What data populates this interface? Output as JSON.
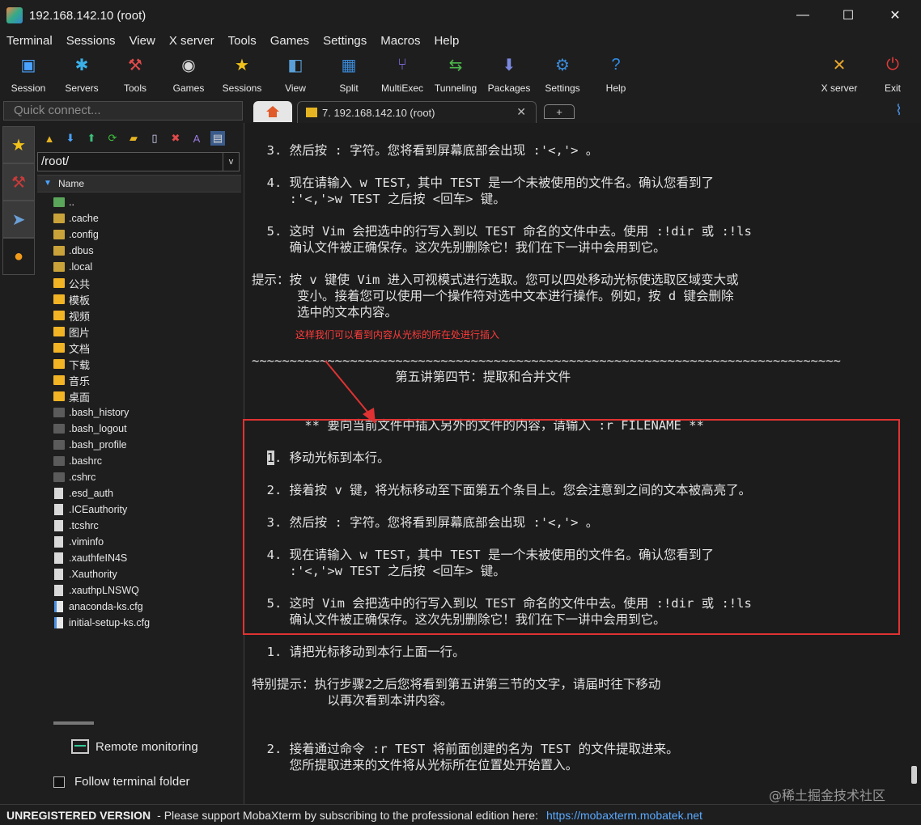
{
  "window": {
    "title": "192.168.142.10 (root)",
    "minimize": "—",
    "maximize": "☐",
    "close": "✕"
  },
  "menu": [
    "Terminal",
    "Sessions",
    "View",
    "X server",
    "Tools",
    "Games",
    "Settings",
    "Macros",
    "Help"
  ],
  "toolbar": {
    "items": [
      {
        "label": "Session",
        "icon": "session-icon",
        "glyph": "▣",
        "color": "#4aa3ff"
      },
      {
        "label": "Servers",
        "icon": "servers-icon",
        "glyph": "✱",
        "color": "#3ab0e8"
      },
      {
        "label": "Tools",
        "icon": "tools-icon",
        "glyph": "⚒",
        "color": "#e04a4a"
      },
      {
        "label": "Games",
        "icon": "games-icon",
        "glyph": "◉",
        "color": "#d8d8d8"
      },
      {
        "label": "Sessions",
        "icon": "sessions-star-icon",
        "glyph": "★",
        "color": "#f2c21b"
      },
      {
        "label": "View",
        "icon": "view-icon",
        "glyph": "◧",
        "color": "#5aa0d8"
      },
      {
        "label": "Split",
        "icon": "split-icon",
        "glyph": "▦",
        "color": "#3a8ad8"
      },
      {
        "label": "MultiExec",
        "icon": "multiexec-icon",
        "glyph": "⑂",
        "color": "#7a6ad8"
      },
      {
        "label": "Tunneling",
        "icon": "tunneling-icon",
        "glyph": "⇆",
        "color": "#4cb84c"
      },
      {
        "label": "Packages",
        "icon": "packages-icon",
        "glyph": "⬇",
        "color": "#7a8ae0"
      },
      {
        "label": "Settings",
        "icon": "settings-icon",
        "glyph": "⚙",
        "color": "#3a8ad8"
      },
      {
        "label": "Help",
        "icon": "help-icon",
        "glyph": "?",
        "color": "#2f8de4"
      },
      {
        "label": "X server",
        "icon": "xserver-icon",
        "glyph": "✕",
        "color": "#e6a52c"
      },
      {
        "label": "Exit",
        "icon": "exit-icon",
        "glyph": "⏻",
        "color": "#e63a3a"
      }
    ]
  },
  "quick_connect": {
    "placeholder": "Quick connect..."
  },
  "tabs": {
    "session_label": "7. 192.168.142.10 (root)",
    "close": "✕",
    "new_tab": "+"
  },
  "sidebar": {
    "path": "/root/",
    "column_header": "Name",
    "files": [
      {
        "name": "..",
        "type": "up"
      },
      {
        "name": ".cache",
        "type": "dot"
      },
      {
        "name": ".config",
        "type": "dot"
      },
      {
        "name": ".dbus",
        "type": "dot"
      },
      {
        "name": ".local",
        "type": "dot"
      },
      {
        "name": "公共",
        "type": "folder"
      },
      {
        "name": "模板",
        "type": "folder"
      },
      {
        "name": "视频",
        "type": "folder"
      },
      {
        "name": "图片",
        "type": "folder"
      },
      {
        "name": "文档",
        "type": "folder"
      },
      {
        "name": "下载",
        "type": "folder"
      },
      {
        "name": "音乐",
        "type": "folder"
      },
      {
        "name": "桌面",
        "type": "folder"
      },
      {
        "name": ".bash_history",
        "type": "hidden"
      },
      {
        "name": ".bash_logout",
        "type": "hidden"
      },
      {
        "name": ".bash_profile",
        "type": "hidden"
      },
      {
        "name": ".bashrc",
        "type": "hidden"
      },
      {
        "name": ".cshrc",
        "type": "hidden"
      },
      {
        "name": ".esd_auth",
        "type": "file"
      },
      {
        "name": ".ICEauthority",
        "type": "file"
      },
      {
        "name": ".tcshrc",
        "type": "file"
      },
      {
        "name": ".viminfo",
        "type": "file"
      },
      {
        "name": ".xauthfeIN4S",
        "type": "file"
      },
      {
        "name": ".Xauthority",
        "type": "file"
      },
      {
        "name": ".xauthpLNSWQ",
        "type": "file"
      },
      {
        "name": "anaconda-ks.cfg",
        "type": "cfg"
      },
      {
        "name": "initial-setup-ks.cfg",
        "type": "cfg"
      }
    ],
    "remote_monitoring": "Remote monitoring",
    "follow_terminal": "Follow terminal folder"
  },
  "terminal": {
    "lines": [
      "  3. 然后按 : 字符。您将看到屏幕底部会出现 :'<,'> 。",
      "",
      "  4. 现在请输入 w TEST，其中 TEST 是一个未被使用的文件名。确认您看到了",
      "     :'<,'>w TEST 之后按 <回车> 键。",
      "",
      "  5. 这时 Vim 会把选中的行写入到以 TEST 命名的文件中去。使用 :!dir 或 :!ls",
      "     确认文件被正确保存。这次先别删除它！我们在下一讲中会用到它。",
      "",
      "提示：按 v 键使 Vim 进入可视模式进行选取。您可以四处移动光标使选取区域变大或",
      "      变小。接着您可以使用一个操作符对选中文本进行操作。例如，按 d 键会删除",
      "      选中的文本内容。",
      "",
      "",
      "~~~~~~~~~~~~~~~~~~~~~~~~~~~~~~~~~~~~~~~~~~~~~~~~~~~~~~~~~~~~~~~~~~~~~~~~~~~~~~",
      "                   第五讲第四节：提取和合并文件",
      "",
      "",
      "       ** 要向当前文件中插入另外的文件的内容，请输入 :r FILENAME **",
      "",
      "  1. 移动光标到本行。",
      "",
      "  2. 接着按 v 键，将光标移动至下面第五个条目上。您会注意到之间的文本被高亮了。",
      "",
      "  3. 然后按 : 字符。您将看到屏幕底部会出现 :'<,'> 。",
      "",
      "  4. 现在请输入 w TEST，其中 TEST 是一个未被使用的文件名。确认您看到了",
      "     :'<,'>w TEST 之后按 <回车> 键。",
      "",
      "  5. 这时 Vim 会把选中的行写入到以 TEST 命名的文件中去。使用 :!dir 或 :!ls",
      "     确认文件被正确保存。这次先别删除它！我们在下一讲中会用到它。",
      "",
      "  1. 请把光标移动到本行上面一行。",
      "",
      "特别提示：执行步骤2之后您将看到第五讲第三节的文字，请届时往下移动",
      "          以再次看到本讲内容。",
      "",
      "",
      "  2. 接着通过命令 :r TEST 将前面创建的名为 TEST 的文件提取进来。",
      "     您所提取进来的文件将从光标所在位置处开始置入。"
    ],
    "annotation": "这样我们可以看到内容从光标的所在处进行插入",
    "watermark": "@稀土掘金技术社区"
  },
  "status": {
    "unregistered": "UNREGISTERED VERSION",
    "message": "-  Please support MobaXterm by subscribing to the professional edition here:",
    "link": "https://mobaxterm.mobatek.net"
  },
  "colors": {
    "highlight_box": "#e03232",
    "annotation": "#ff3b3b",
    "link": "#5aa9ff"
  }
}
